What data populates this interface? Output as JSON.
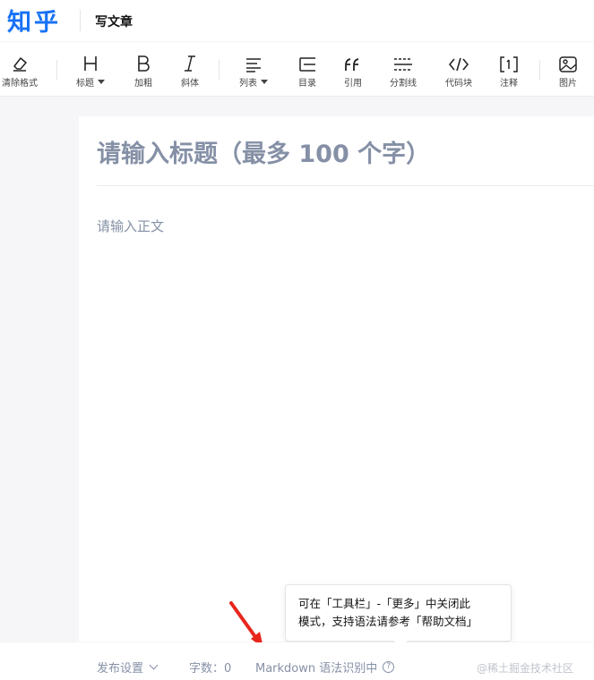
{
  "header": {
    "logo": "知乎",
    "title": "写文章"
  },
  "toolbar": {
    "items": [
      {
        "label": "清除格式",
        "icon": "eraser-icon"
      },
      {
        "label": "标题",
        "icon": "heading-icon",
        "dropdown": true
      },
      {
        "label": "加粗",
        "icon": "bold-icon"
      },
      {
        "label": "斜体",
        "icon": "italic-icon"
      },
      {
        "label": "列表",
        "icon": "list-icon",
        "dropdown": true
      },
      {
        "label": "目录",
        "icon": "toc-icon"
      },
      {
        "label": "引用",
        "icon": "quote-icon"
      },
      {
        "label": "分割线",
        "icon": "divider-icon"
      },
      {
        "label": "代码块",
        "icon": "code-icon"
      },
      {
        "label": "注释",
        "icon": "footnote-icon"
      },
      {
        "label": "图片",
        "icon": "image-icon"
      }
    ]
  },
  "editor": {
    "title_placeholder": "请输入标题（最多 100 个字）",
    "body_placeholder": "请输入正文"
  },
  "tooltip": {
    "line1": "可在「工具栏」-「更多」中关闭此",
    "line2": "模式，支持语法请参考「帮助文档」"
  },
  "bottombar": {
    "publish_settings": "发布设置",
    "word_count_label": "字数：",
    "word_count": "0",
    "markdown_status": "Markdown 语法识别中",
    "help_glyph": "?",
    "watermark": "@稀土掘金技术社区"
  },
  "colors": {
    "brand": "#1772f6",
    "placeholder": "#8590a6",
    "annotation_arrow": "#e8261c"
  }
}
